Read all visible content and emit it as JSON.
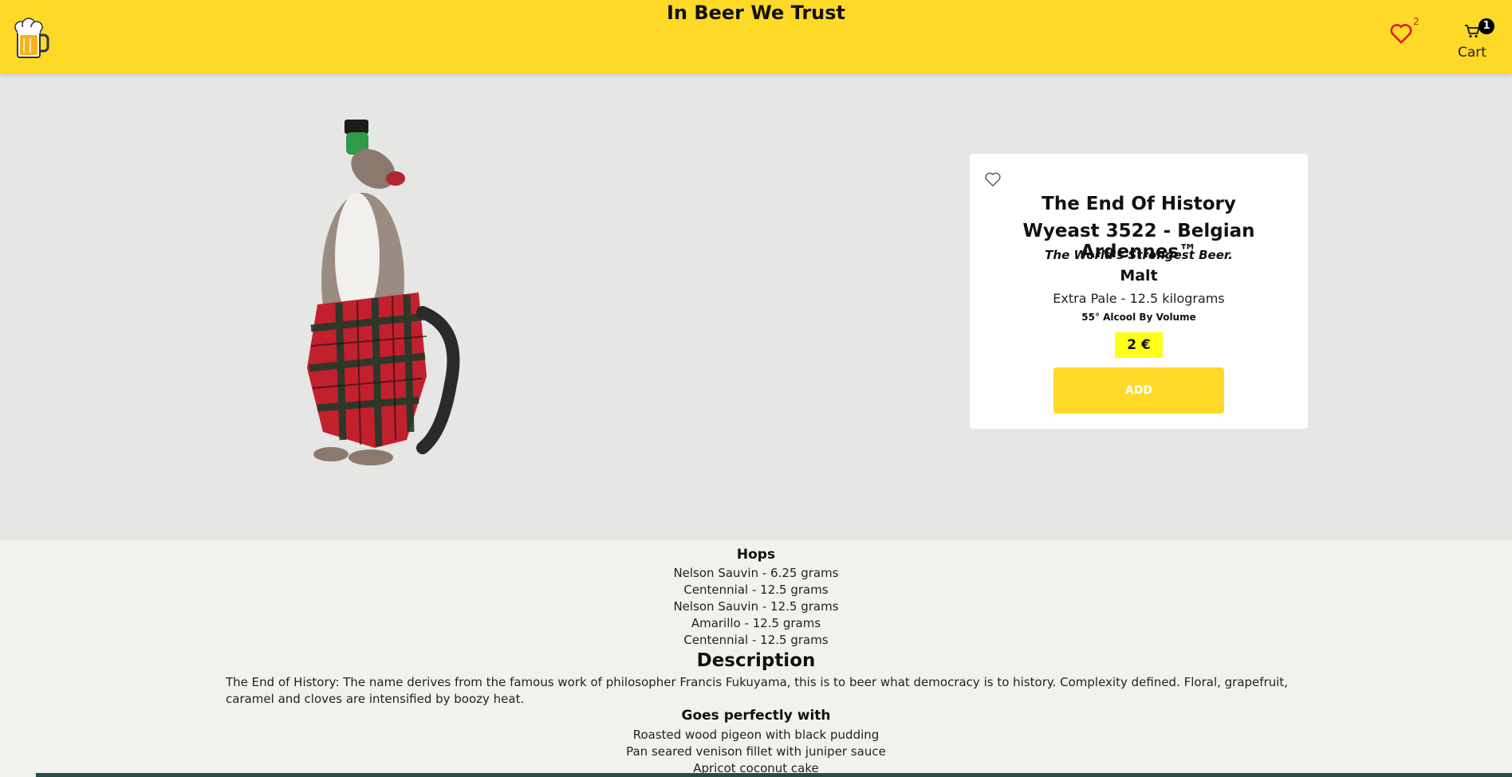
{
  "header": {
    "title": "In Beer We Trust",
    "favorites_count": "2",
    "cart_count": "1",
    "cart_label": "Cart",
    "logo_icon": "beer-mug-icon",
    "favorites_icon": "heart-icon",
    "cart_icon": "cart-icon",
    "accent_color": "#ffd928"
  },
  "product": {
    "image_icon": "cat-bottle-product-image",
    "name": "The End Of History",
    "yeast": "Wyeast 3522 - Belgian Ardennes™",
    "tagline": "The World's Strongest Beer.",
    "malt_title": "Malt",
    "malt_item": "Extra Pale - 12.5  kilograms",
    "abv": "55° Alcool By Volume",
    "price": "2 €",
    "add_label": "ADD",
    "price_color": "#ffff1a"
  },
  "details": {
    "hops_title": "Hops",
    "hops": [
      "Nelson Sauvin - 6.25 grams",
      "Centennial - 12.5 grams",
      "Nelson Sauvin - 12.5 grams",
      "Amarillo - 12.5 grams",
      "Centennial - 12.5 grams"
    ],
    "description_title": "Description",
    "description": "The End of History: The name derives from the famous work of philosopher Francis Fukuyama, this is to beer what democracy is to history. Complexity defined. Floral, grapefruit, caramel and cloves are intensified by boozy heat.",
    "pairing_title": "Goes perfectly with",
    "pairings": [
      "Roasted wood pigeon with black pudding",
      "Pan seared venison fillet with juniper sauce",
      "Apricot coconut cake"
    ]
  }
}
